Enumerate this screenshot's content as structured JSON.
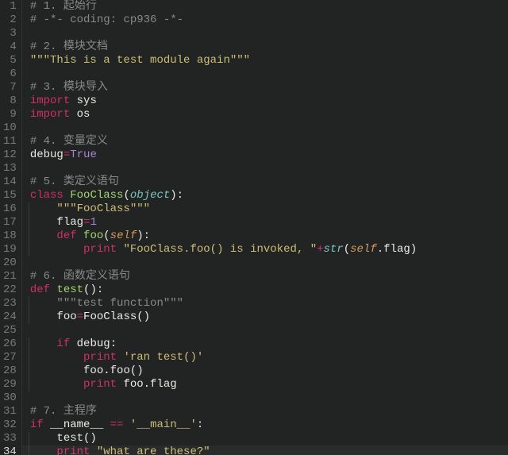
{
  "total_lines": 34,
  "current_line": 34,
  "lines": [
    {
      "n": 1,
      "tokens": [
        {
          "c": "tok-comment",
          "t": "# 1. 起始行"
        }
      ]
    },
    {
      "n": 2,
      "tokens": [
        {
          "c": "tok-comment",
          "t": "# -*- coding: cp936 -*-"
        }
      ]
    },
    {
      "n": 3,
      "tokens": []
    },
    {
      "n": 4,
      "tokens": [
        {
          "c": "tok-comment",
          "t": "# 2. 模块文档"
        }
      ]
    },
    {
      "n": 5,
      "tokens": [
        {
          "c": "tok-string",
          "t": "\"\"\"This is a test module again\"\"\""
        }
      ]
    },
    {
      "n": 6,
      "tokens": []
    },
    {
      "n": 7,
      "tokens": [
        {
          "c": "tok-comment",
          "t": "# 3. 模块导入"
        }
      ]
    },
    {
      "n": 8,
      "tokens": [
        {
          "c": "tok-keyword",
          "t": "import"
        },
        {
          "c": "tok-text",
          "t": " sys"
        }
      ]
    },
    {
      "n": 9,
      "tokens": [
        {
          "c": "tok-keyword",
          "t": "import"
        },
        {
          "c": "tok-text",
          "t": " os"
        }
      ]
    },
    {
      "n": 10,
      "tokens": []
    },
    {
      "n": 11,
      "tokens": [
        {
          "c": "tok-comment",
          "t": "# 4. 变量定义"
        }
      ]
    },
    {
      "n": 12,
      "tokens": [
        {
          "c": "tok-name",
          "t": "debug"
        },
        {
          "c": "tok-op",
          "t": "="
        },
        {
          "c": "tok-bool",
          "t": "True"
        }
      ]
    },
    {
      "n": 13,
      "tokens": []
    },
    {
      "n": 14,
      "tokens": [
        {
          "c": "tok-comment",
          "t": "# 5. 类定义语句"
        }
      ]
    },
    {
      "n": 15,
      "tokens": [
        {
          "c": "tok-keyword-def",
          "t": "class"
        },
        {
          "c": "tok-text",
          "t": " "
        },
        {
          "c": "tok-class",
          "t": "FooClass"
        },
        {
          "c": "tok-text",
          "t": "("
        },
        {
          "c": "tok-builtin",
          "t": "object"
        },
        {
          "c": "tok-text",
          "t": "):"
        }
      ]
    },
    {
      "n": 16,
      "indent": 1,
      "tokens": [
        {
          "c": "tok-string",
          "t": "\"\"\"FooClass\"\"\""
        }
      ]
    },
    {
      "n": 17,
      "indent": 1,
      "tokens": [
        {
          "c": "tok-name",
          "t": "flag"
        },
        {
          "c": "tok-op",
          "t": "="
        },
        {
          "c": "tok-num",
          "t": "1"
        }
      ]
    },
    {
      "n": 18,
      "indent": 1,
      "tokens": [
        {
          "c": "tok-keyword-def",
          "t": "def"
        },
        {
          "c": "tok-text",
          "t": " "
        },
        {
          "c": "tok-func",
          "t": "foo"
        },
        {
          "c": "tok-text",
          "t": "("
        },
        {
          "c": "tok-self",
          "t": "self"
        },
        {
          "c": "tok-text",
          "t": "):"
        }
      ]
    },
    {
      "n": 19,
      "indent": 2,
      "tokens": [
        {
          "c": "tok-keyword",
          "t": "print"
        },
        {
          "c": "tok-text",
          "t": " "
        },
        {
          "c": "tok-string",
          "t": "\"FooClass.foo() is invoked, \""
        },
        {
          "c": "tok-op",
          "t": "+"
        },
        {
          "c": "tok-builtin",
          "t": "str"
        },
        {
          "c": "tok-text",
          "t": "("
        },
        {
          "c": "tok-self",
          "t": "self"
        },
        {
          "c": "tok-text",
          "t": ".flag)"
        }
      ]
    },
    {
      "n": 20,
      "tokens": []
    },
    {
      "n": 21,
      "tokens": [
        {
          "c": "tok-comment",
          "t": "# 6. 函数定义语句"
        }
      ]
    },
    {
      "n": 22,
      "tokens": [
        {
          "c": "tok-keyword-def",
          "t": "def"
        },
        {
          "c": "tok-text",
          "t": " "
        },
        {
          "c": "tok-func",
          "t": "test"
        },
        {
          "c": "tok-text",
          "t": "():"
        }
      ]
    },
    {
      "n": 23,
      "indent": 1,
      "tokens": [
        {
          "c": "tok-comment",
          "t": "\"\"\"test function\"\"\""
        }
      ]
    },
    {
      "n": 24,
      "indent": 1,
      "tokens": [
        {
          "c": "tok-name",
          "t": "foo"
        },
        {
          "c": "tok-op",
          "t": "="
        },
        {
          "c": "tok-text",
          "t": "FooClass()"
        }
      ]
    },
    {
      "n": 25,
      "tokens": []
    },
    {
      "n": 26,
      "indent": 1,
      "tokens": [
        {
          "c": "tok-keyword",
          "t": "if"
        },
        {
          "c": "tok-text",
          "t": " debug:"
        }
      ]
    },
    {
      "n": 27,
      "indent": 2,
      "tokens": [
        {
          "c": "tok-keyword",
          "t": "print"
        },
        {
          "c": "tok-text",
          "t": " "
        },
        {
          "c": "tok-string",
          "t": "'ran test()'"
        }
      ]
    },
    {
      "n": 28,
      "indent": 2,
      "tokens": [
        {
          "c": "tok-text",
          "t": "foo.foo()"
        }
      ]
    },
    {
      "n": 29,
      "indent": 2,
      "tokens": [
        {
          "c": "tok-keyword",
          "t": "print"
        },
        {
          "c": "tok-text",
          "t": " foo.flag"
        }
      ]
    },
    {
      "n": 30,
      "tokens": []
    },
    {
      "n": 31,
      "tokens": [
        {
          "c": "tok-comment",
          "t": "# 7. 主程序"
        }
      ]
    },
    {
      "n": 32,
      "tokens": [
        {
          "c": "tok-keyword",
          "t": "if"
        },
        {
          "c": "tok-text",
          "t": " __name__ "
        },
        {
          "c": "tok-op",
          "t": "=="
        },
        {
          "c": "tok-text",
          "t": " "
        },
        {
          "c": "tok-string",
          "t": "'__main__'"
        },
        {
          "c": "tok-text",
          "t": ":"
        }
      ]
    },
    {
      "n": 33,
      "indent": 1,
      "tokens": [
        {
          "c": "tok-text",
          "t": "test()"
        }
      ]
    },
    {
      "n": 34,
      "indent": 1,
      "tokens": [
        {
          "c": "tok-keyword",
          "t": "print"
        },
        {
          "c": "tok-text",
          "t": " "
        },
        {
          "c": "tok-string",
          "t": "\"what are these?\""
        }
      ]
    }
  ]
}
